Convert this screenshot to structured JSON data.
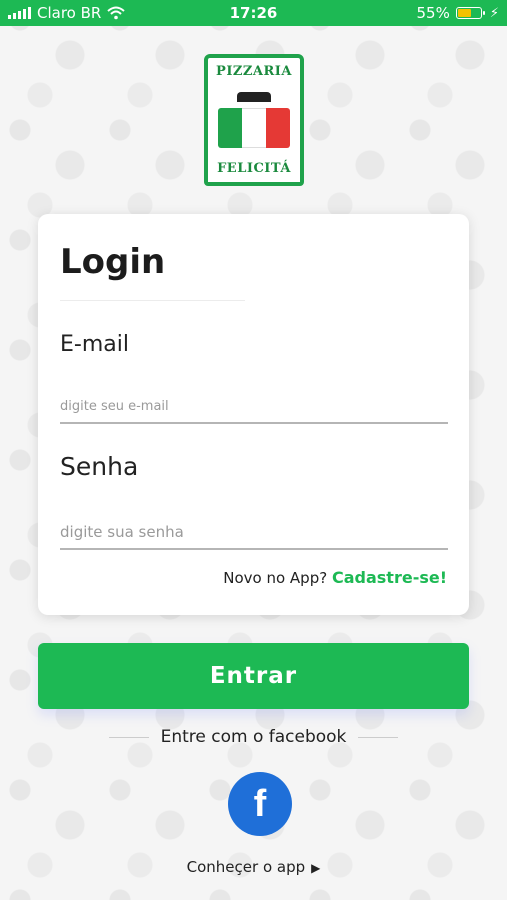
{
  "status_bar": {
    "carrier": "Claro BR",
    "time": "17:26",
    "battery": "55%",
    "battery_level": 0.55,
    "signal_icon": "signal-bars-icon",
    "wifi_icon": "wifi-icon",
    "battery_icon": "battery-icon",
    "charging_icon": "charging-bolt-icon"
  },
  "logo": {
    "top_text": "PIZZARIA",
    "bottom_text": "FELICITÁ",
    "colors": [
      "#1fa24b",
      "#ffffff",
      "#e53935"
    ]
  },
  "login": {
    "title": "Login",
    "email_label": "E-mail",
    "email_placeholder": "digite seu e-mail",
    "email_value": "",
    "password_label": "Senha",
    "password_placeholder": "digite sua senha",
    "password_value": "",
    "new_user_text": "Novo no App?",
    "signup_link": "Cadastre-se!"
  },
  "actions": {
    "enter_label": "Entrar",
    "facebook_text": "Entre com o facebook",
    "facebook_icon": "facebook-icon",
    "know_app_text": "Conheçer o app",
    "know_app_icon": "chevron-right-icon"
  },
  "colors": {
    "primary": "#1db954",
    "facebook": "#1f6fd8"
  }
}
